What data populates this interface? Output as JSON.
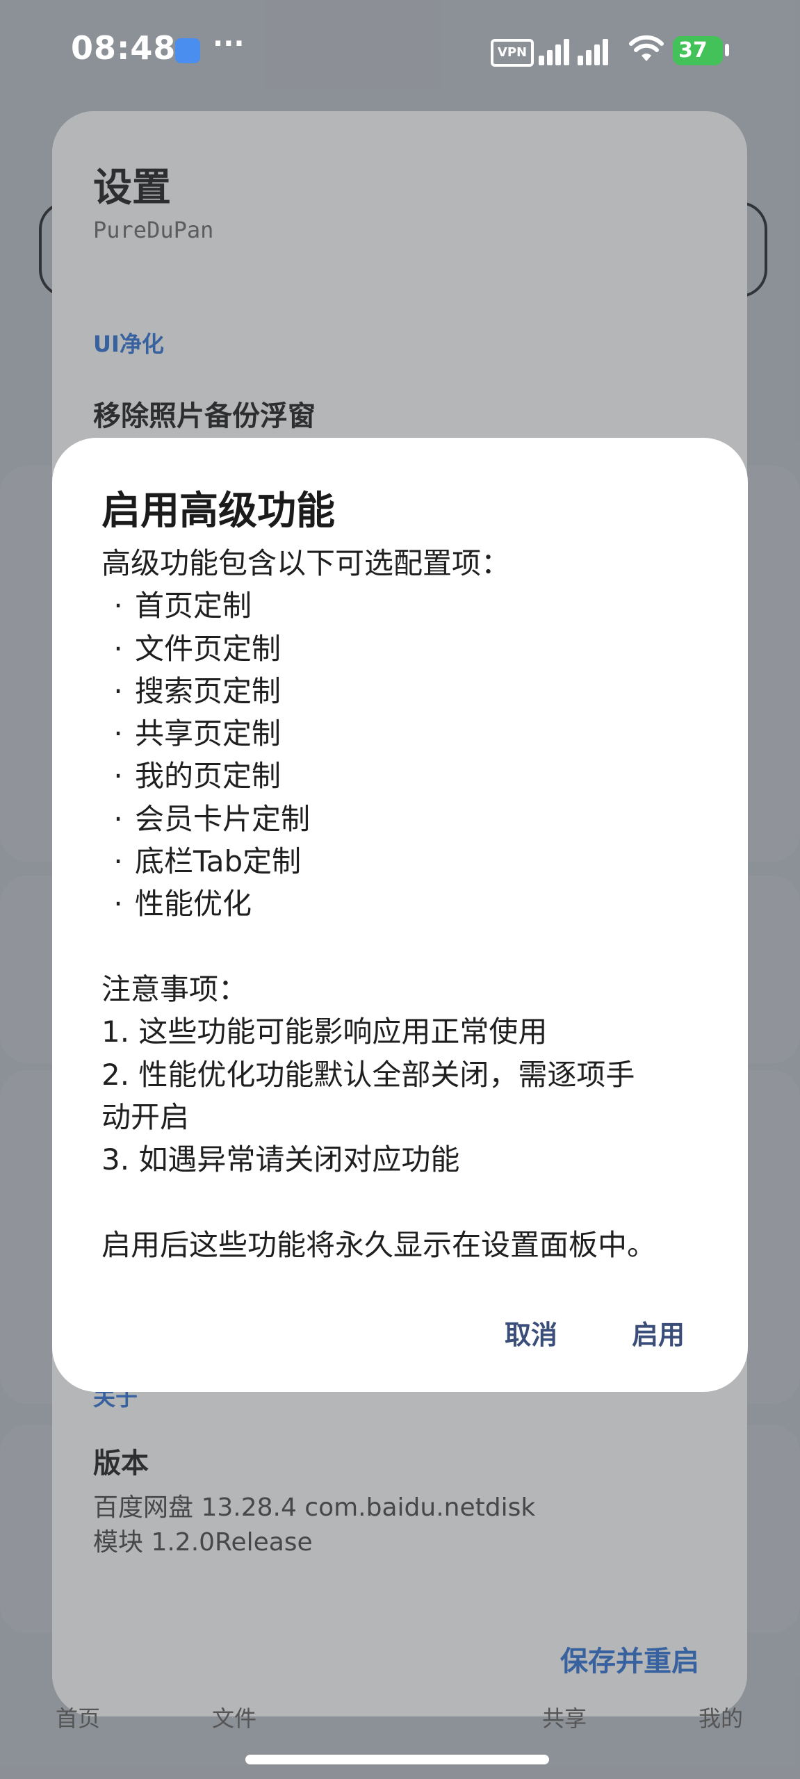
{
  "status_bar": {
    "time": "08:48",
    "more": "···",
    "vpn": "VPN",
    "battery": "37"
  },
  "settings_sheet": {
    "title": "设置",
    "subtitle": "PureDuPan",
    "section_ui": "UI净化",
    "item_remove_backup_float": "移除照片备份浮窗",
    "section_about": "关于",
    "version_title": "版本",
    "version_app": "百度网盘 13.28.4 com.baidu.netdisk",
    "version_module": "模块 1.2.0Release",
    "save_restart": "保存并重启"
  },
  "bottom_nav": {
    "home": "首页",
    "files": "文件",
    "share": "共享",
    "mine": "我的"
  },
  "dialog": {
    "title": "启用高级功能",
    "intro": "高级功能包含以下可选配置项：",
    "bullet": "·",
    "items": [
      "首页定制",
      "文件页定制",
      "搜索页定制",
      "共享页定制",
      "我的页定制",
      "会员卡片定制",
      "底栏Tab定制",
      "性能优化"
    ],
    "notes_title": "注意事项：",
    "note_1": "1. 这些功能可能影响应用正常使用",
    "note_2a": "2. 性能优化功能默认全部关闭，需逐项手",
    "note_2b": "动开启",
    "note_3": "3. 如遇异常请关闭对应功能",
    "footer": "启用后这些功能将永久显示在设置面板中。",
    "cancel": "取消",
    "enable": "启用"
  },
  "colors": {
    "accent": "#2f6fd1",
    "dialog_button": "#3b4e79",
    "battery": "#43c25a"
  }
}
